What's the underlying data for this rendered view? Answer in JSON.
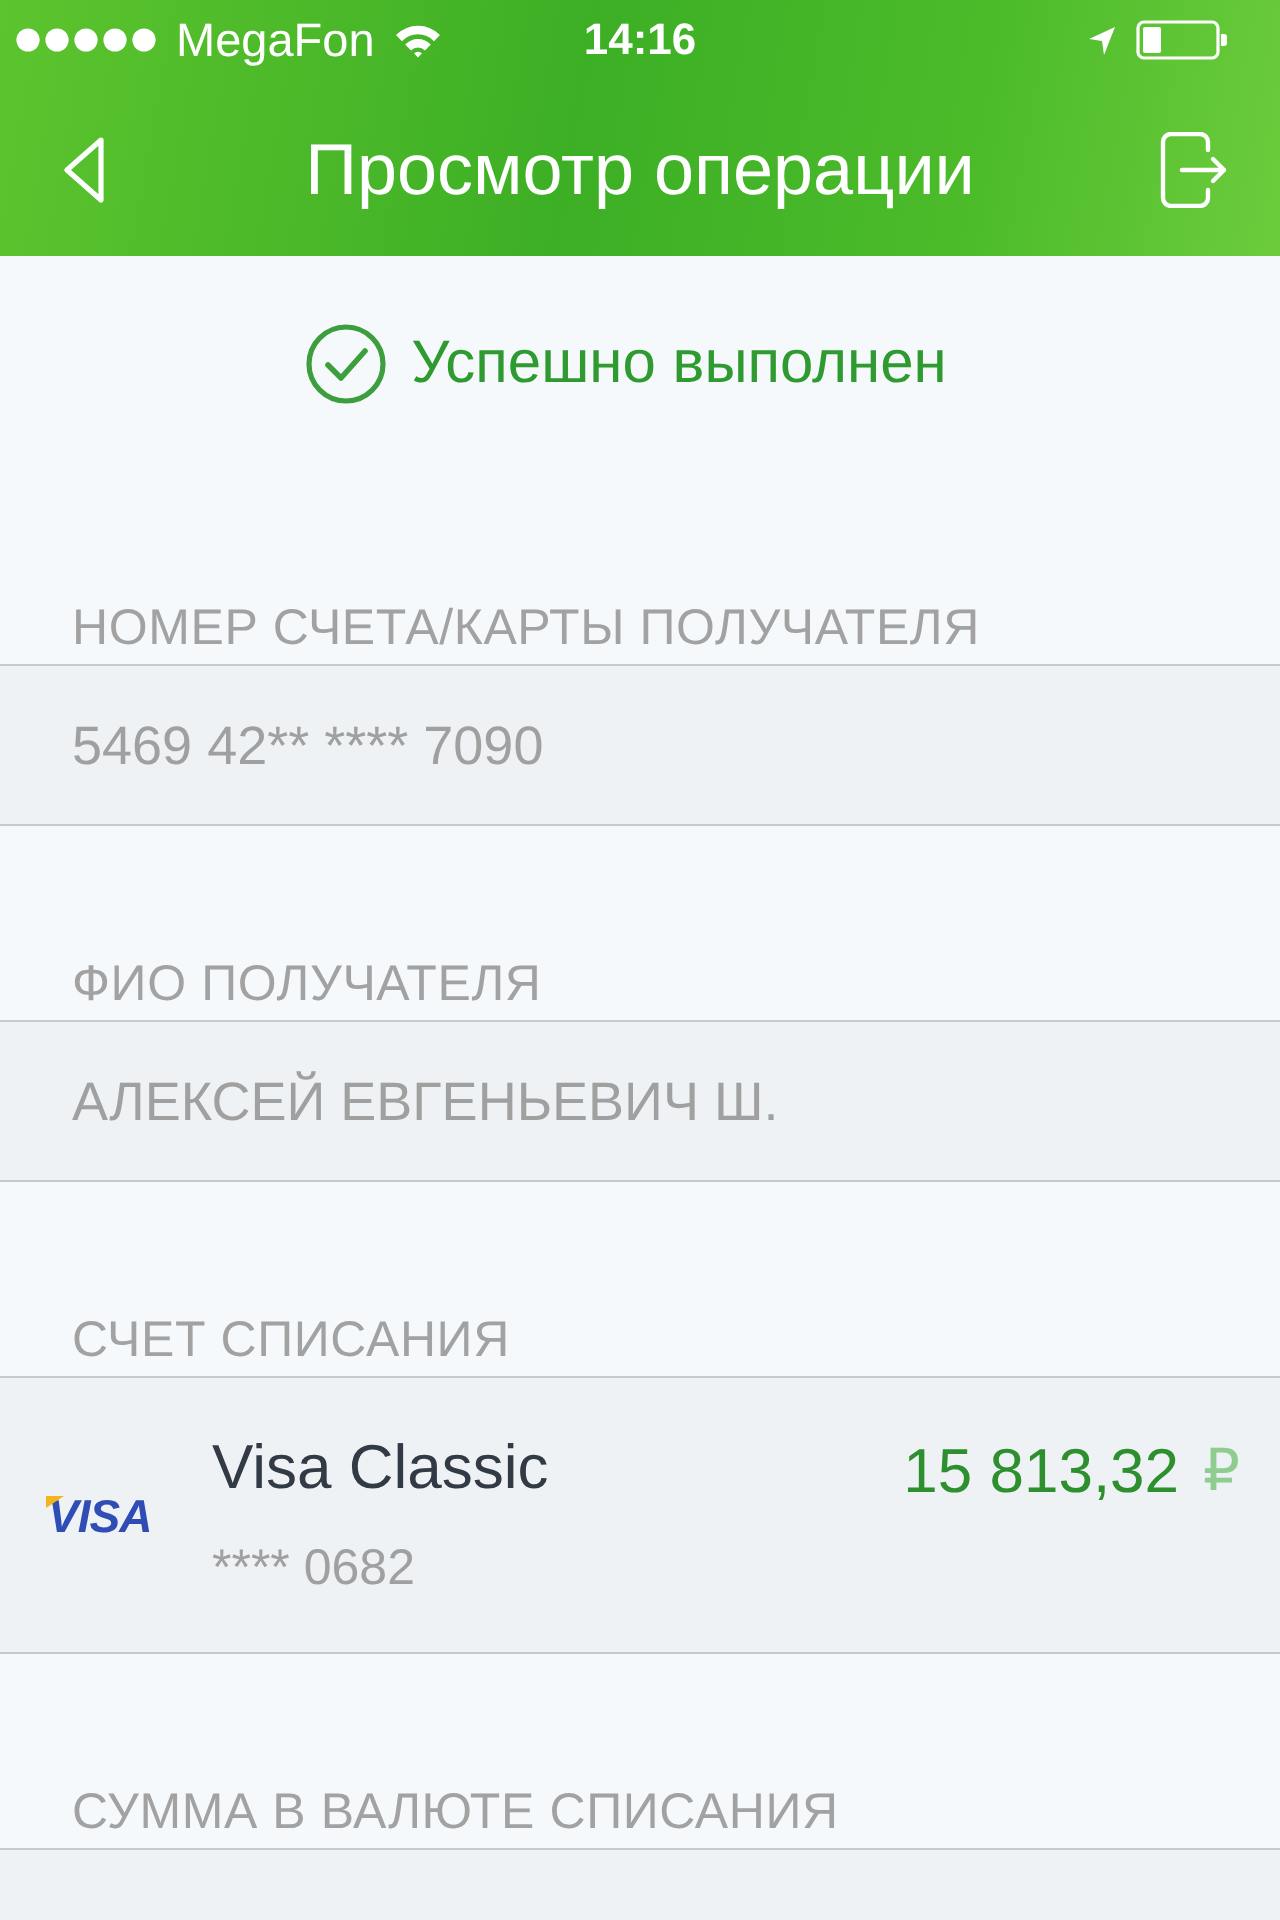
{
  "status_bar": {
    "carrier": "MegaFon",
    "time": "14:16"
  },
  "header": {
    "title": "Просмотр операции"
  },
  "status": {
    "text": "Успешно выполнен"
  },
  "sections": [
    {
      "kind": "text",
      "label": "НОМЕР СЧЕТА/КАРТЫ ПОЛУЧАТЕЛЯ",
      "value": "5469 42** **** 7090"
    },
    {
      "kind": "text",
      "label": "ФИО ПОЛУЧАТЕЛЯ",
      "value": "АЛЕКСЕЙ ЕВГЕНЬЕВИЧ Ш."
    },
    {
      "kind": "card",
      "label": "СЧЕТ СПИСАНИЯ",
      "card": {
        "logo": "VISA",
        "name": "Visa Classic",
        "number": "**** 0682",
        "amount": "15 813,32",
        "currency": "₽"
      }
    },
    {
      "kind": "text",
      "label": "СУММА В ВАЛЮТЕ СПИСАНИЯ"
    }
  ]
}
